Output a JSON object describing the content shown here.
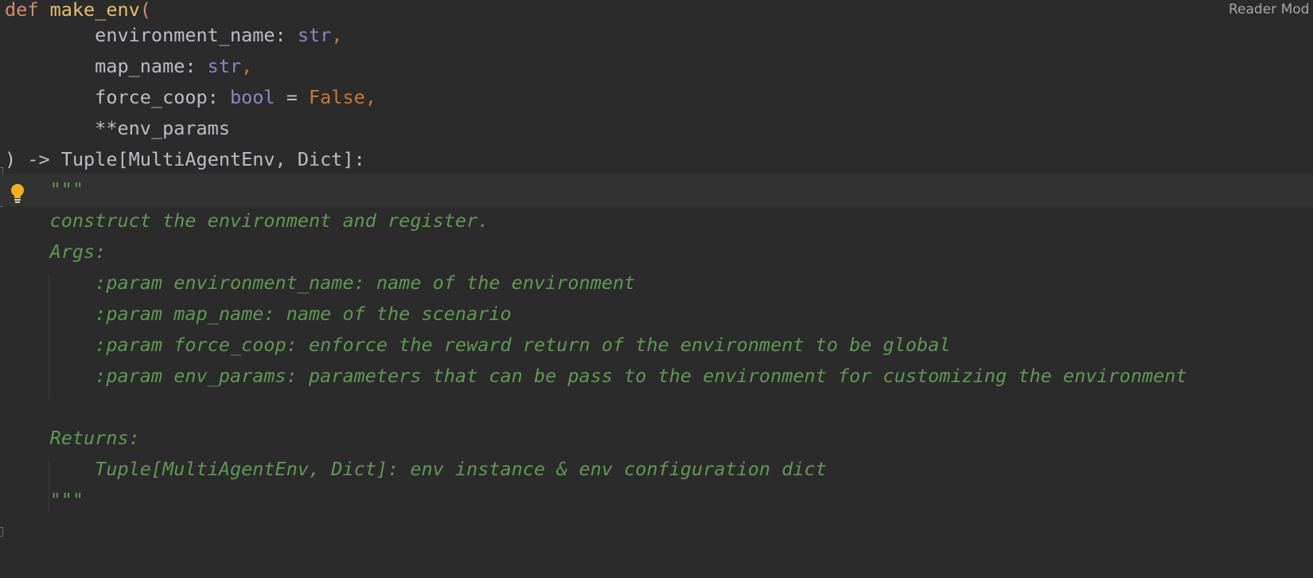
{
  "header": {
    "reader_mode_label": "Reader Mod"
  },
  "code": {
    "lines": [
      {
        "tokens": [
          {
            "t": "def ",
            "c": "kw"
          },
          {
            "t": "make_env",
            "c": "fn"
          },
          {
            "t": "(",
            "c": "kw"
          }
        ]
      },
      {
        "tokens": [
          {
            "t": "        environment_name: ",
            "c": "plain"
          },
          {
            "t": "str",
            "c": "typ"
          },
          {
            "t": ",",
            "c": "comma"
          }
        ]
      },
      {
        "tokens": [
          {
            "t": "        map_name: ",
            "c": "plain"
          },
          {
            "t": "str",
            "c": "typ"
          },
          {
            "t": ",",
            "c": "comma"
          }
        ]
      },
      {
        "tokens": [
          {
            "t": "        force_coop: ",
            "c": "plain"
          },
          {
            "t": "bool",
            "c": "typ"
          },
          {
            "t": " = ",
            "c": "plain"
          },
          {
            "t": "False",
            "c": "const"
          },
          {
            "t": ",",
            "c": "comma"
          }
        ]
      },
      {
        "tokens": [
          {
            "t": "        **env_params",
            "c": "plain"
          }
        ]
      },
      {
        "tokens": [
          {
            "t": ") -> Tuple[MultiAgentEnv, Dict]:",
            "c": "plain"
          }
        ]
      },
      {
        "tokens": [
          {
            "t": "    \"\"\"",
            "c": "doc"
          }
        ]
      },
      {
        "tokens": [
          {
            "t": "    construct the environment and register.",
            "c": "doc"
          }
        ]
      },
      {
        "tokens": [
          {
            "t": "    Args:",
            "c": "doc"
          }
        ]
      },
      {
        "tokens": [
          {
            "t": "        :param environment_name: name of the environment",
            "c": "doc"
          }
        ]
      },
      {
        "tokens": [
          {
            "t": "        :param map_name: name of the scenario",
            "c": "doc"
          }
        ]
      },
      {
        "tokens": [
          {
            "t": "        :param force_coop: enforce the reward return of the environment to be global",
            "c": "doc"
          }
        ]
      },
      {
        "tokens": [
          {
            "t": "        :param env_params: parameters that can be pass to the environment for customizing the environment",
            "c": "doc"
          }
        ]
      },
      {
        "tokens": [
          {
            "t": "",
            "c": "doc"
          }
        ]
      },
      {
        "tokens": [
          {
            "t": "    Returns:",
            "c": "doc"
          }
        ]
      },
      {
        "tokens": [
          {
            "t": "        Tuple[MultiAgentEnv, Dict]: env instance & env configuration dict",
            "c": "doc"
          }
        ]
      },
      {
        "tokens": [
          {
            "t": "    \"\"\"",
            "c": "doc"
          }
        ]
      }
    ]
  },
  "colors": {
    "background": "#2b2b2b",
    "current_line": "#323232",
    "keyword": "#cf8e6d",
    "function": "#e8bf6a",
    "type": "#8888c6",
    "docstring": "#629755",
    "bulb": "#f2b01e"
  },
  "icons": {
    "intention": "lightbulb-icon"
  }
}
